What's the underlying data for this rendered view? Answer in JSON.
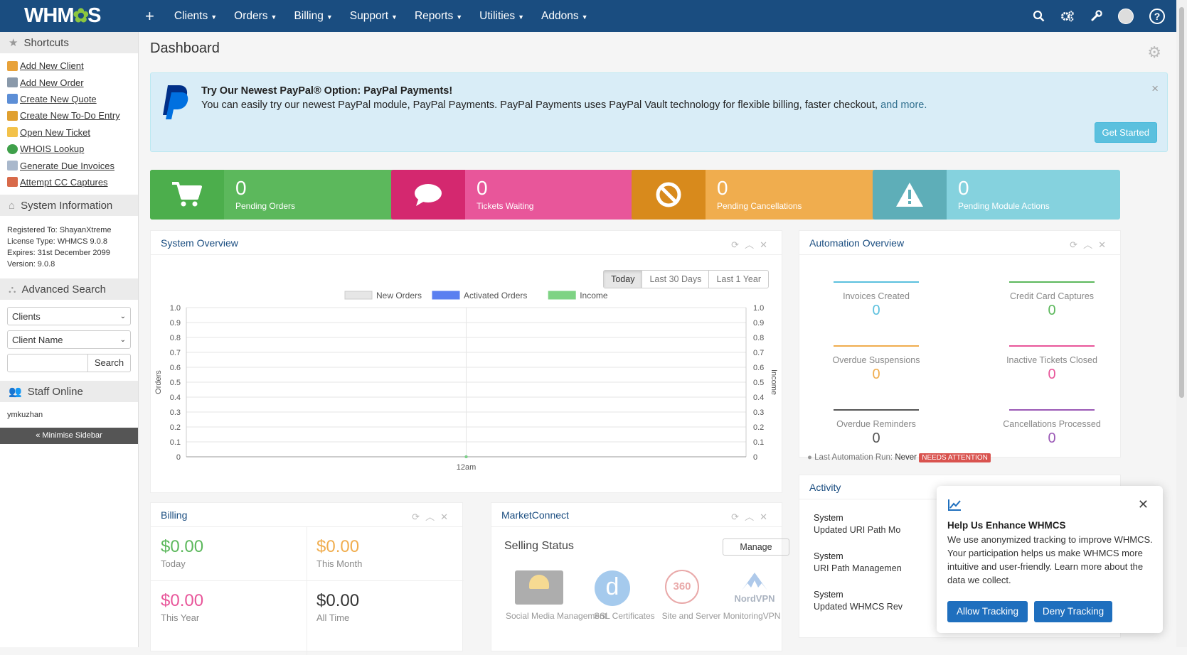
{
  "topnav": {
    "logo_left": "WHM",
    "logo_right": "S",
    "add": "+",
    "menu": [
      "Clients",
      "Orders",
      "Billing",
      "Support",
      "Reports",
      "Utilities",
      "Addons"
    ],
    "icons": [
      "search-icon",
      "cogs-icon",
      "wrench-icon",
      "avatar-icon",
      "help-icon"
    ],
    "help": "?"
  },
  "sidebar": {
    "shortcuts_title": "Shortcuts",
    "shortcuts": [
      "Add New Client",
      "Add New Order",
      "Create New Quote",
      "Create New To-Do Entry",
      "Open New Ticket",
      "WHOIS Lookup",
      "Generate Due Invoices",
      "Attempt CC Captures"
    ],
    "system_info_title": "System Information",
    "system_info": [
      "Registered To: ShayanXtreme",
      "License Type: WHMCS 9.0.8",
      "Expires: 31st December 2099",
      "Version: 9.0.8"
    ],
    "advanced_search_title": "Advanced Search",
    "search_type": "Clients",
    "search_field": "Client Name",
    "search_button": "Search",
    "staff_online_title": "Staff Online",
    "staff": "ymkuzhan",
    "minimise": "« Minimise Sidebar"
  },
  "dashboard": {
    "title": "Dashboard"
  },
  "alert": {
    "title": "Try Our Newest PayPal® Option: PayPal Payments!",
    "text": "You can easily try our newest PayPal module, PayPal Payments. PayPal Payments uses PayPal Vault technology for flexible billing, faster checkout,",
    "more": "and more.",
    "button": "Get Started",
    "close": "×"
  },
  "stats": [
    {
      "value": "0",
      "label": "Pending Orders",
      "color": "#5cb85c",
      "icon_bg": "#4cae4c"
    },
    {
      "value": "0",
      "label": "Tickets Waiting",
      "color": "#e8569a",
      "icon_bg": "#d4286f"
    },
    {
      "value": "0",
      "label": "Pending Cancellations",
      "color": "#f0ad4e",
      "icon_bg": "#d88a1c"
    },
    {
      "value": "0",
      "label": "Pending Module Actions",
      "color": "#85d2de",
      "icon_bg": "#5eaeb8"
    }
  ],
  "system_overview": {
    "title": "System Overview",
    "ranges": [
      "Today",
      "Last 30 Days",
      "Last 1 Year"
    ]
  },
  "chart_data": {
    "type": "line",
    "categories": [
      "12am"
    ],
    "series": [
      {
        "name": "New Orders",
        "values": [
          0
        ]
      },
      {
        "name": "Activated Orders",
        "values": [
          0
        ]
      },
      {
        "name": "Income",
        "values": [
          0
        ]
      }
    ],
    "legend_colors": [
      "#e6e6e6",
      "#5a7ff0",
      "#7ed384"
    ],
    "ylabel": "Orders",
    "y2label": "Income",
    "ylim": [
      0,
      1
    ],
    "yticks": [
      "1.0",
      "0.9",
      "0.8",
      "0.7",
      "0.6",
      "0.5",
      "0.4",
      "0.3",
      "0.2",
      "0.1",
      "0"
    ],
    "grid": true,
    "legend": "top-center"
  },
  "automation": {
    "title": "Automation Overview",
    "items": [
      {
        "label": "Invoices Created",
        "value": "0",
        "color": "#5bc0de"
      },
      {
        "label": "Credit Card Captures",
        "value": "0",
        "color": "#5cb85c"
      },
      {
        "label": "Overdue Suspensions",
        "value": "0",
        "color": "#f0ad4e"
      },
      {
        "label": "Inactive Tickets Closed",
        "value": "0",
        "color": "#e8569a"
      },
      {
        "label": "Overdue Reminders",
        "value": "0",
        "color": "#555555"
      },
      {
        "label": "Cancellations Processed",
        "value": "0",
        "color": "#9b59b6"
      }
    ],
    "last_run_label": "Last Automation Run:",
    "last_run_value": "Never",
    "badge": "NEEDS ATTENTION"
  },
  "activity": {
    "title": "Activity",
    "items": [
      {
        "who": "System",
        "what": "Updated URI Path Mo"
      },
      {
        "who": "System",
        "what": "URI Path Managemen"
      },
      {
        "who": "System",
        "what": "Updated WHMCS Rev"
      }
    ]
  },
  "billing": {
    "title": "Billing",
    "items": [
      {
        "value": "$0.00",
        "label": "Today",
        "color": "#5cb85c"
      },
      {
        "value": "$0.00",
        "label": "This Month",
        "color": "#f0ad4e"
      },
      {
        "value": "$0.00",
        "label": "This Year",
        "color": "#e8569a"
      },
      {
        "value": "$0.00",
        "label": "All Time",
        "color": "#333333"
      }
    ]
  },
  "marketconnect": {
    "title": "MarketConnect",
    "selling_status": "Selling Status",
    "manage": "Manage",
    "products": [
      "Social Media Management",
      "SSL Certificates",
      "Site and Server Monitoring",
      "VPN"
    ],
    "ssl_letter": "d",
    "monitor_text": "360",
    "vpn_text": "NordVPN"
  },
  "popup": {
    "title": "Help Us Enhance WHMCS",
    "body": "We use anonymized tracking to improve WHMCS. Your participation helps us make WHMCS more intuitive and user-friendly.",
    "link": "Learn more about the data we collect.",
    "allow": "Allow Tracking",
    "deny": "Deny Tracking",
    "close": "✕"
  }
}
